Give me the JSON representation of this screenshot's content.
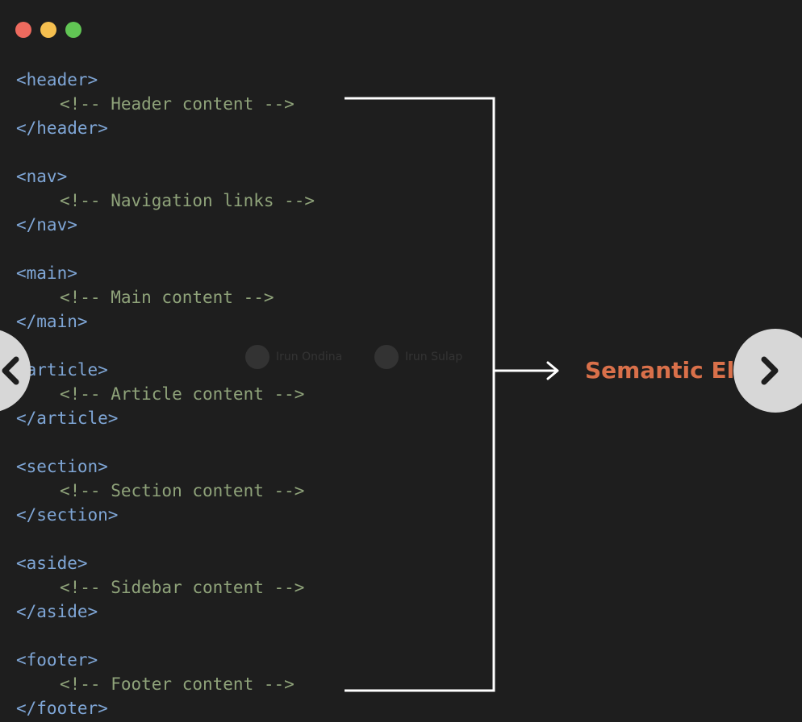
{
  "window": {
    "controls": [
      {
        "name": "close",
        "color": "#ed6a5e"
      },
      {
        "name": "minimize",
        "color": "#f5bf4f"
      },
      {
        "name": "maximize",
        "color": "#61c554"
      }
    ]
  },
  "code": [
    {
      "indent": false,
      "kind": "tag",
      "text": "<header>"
    },
    {
      "indent": true,
      "kind": "comment",
      "text": "<!-- Header content -->"
    },
    {
      "indent": false,
      "kind": "tag",
      "text": "</header>"
    },
    {
      "indent": false,
      "kind": "blank",
      "text": ""
    },
    {
      "indent": false,
      "kind": "tag",
      "text": "<nav>"
    },
    {
      "indent": true,
      "kind": "comment",
      "text": "<!-- Navigation links -->"
    },
    {
      "indent": false,
      "kind": "tag",
      "text": "</nav>"
    },
    {
      "indent": false,
      "kind": "blank",
      "text": ""
    },
    {
      "indent": false,
      "kind": "tag",
      "text": "<main>"
    },
    {
      "indent": true,
      "kind": "comment",
      "text": "<!-- Main content -->"
    },
    {
      "indent": false,
      "kind": "tag",
      "text": "</main>"
    },
    {
      "indent": false,
      "kind": "blank",
      "text": ""
    },
    {
      "indent": false,
      "kind": "tag",
      "text": "<article>"
    },
    {
      "indent": true,
      "kind": "comment",
      "text": "<!-- Article content -->"
    },
    {
      "indent": false,
      "kind": "tag",
      "text": "</article>"
    },
    {
      "indent": false,
      "kind": "blank",
      "text": ""
    },
    {
      "indent": false,
      "kind": "tag",
      "text": "<section>"
    },
    {
      "indent": true,
      "kind": "comment",
      "text": "<!-- Section content -->"
    },
    {
      "indent": false,
      "kind": "tag",
      "text": "</section>"
    },
    {
      "indent": false,
      "kind": "blank",
      "text": ""
    },
    {
      "indent": false,
      "kind": "tag",
      "text": "<aside>"
    },
    {
      "indent": true,
      "kind": "comment",
      "text": "<!-- Sidebar content -->"
    },
    {
      "indent": false,
      "kind": "tag",
      "text": "</aside>"
    },
    {
      "indent": false,
      "kind": "blank",
      "text": ""
    },
    {
      "indent": false,
      "kind": "tag",
      "text": "<footer>"
    },
    {
      "indent": true,
      "kind": "comment",
      "text": "<!-- Footer content -->"
    },
    {
      "indent": false,
      "kind": "tag",
      "text": "</footer>"
    }
  ],
  "diagram": {
    "label": "Semantic Elements",
    "label_color": "#d9704a",
    "line_color": "#ffffff"
  },
  "colors": {
    "background": "#1e1e1e",
    "tag": "#7fa6d6",
    "comment": "#8fa37a",
    "nav_button": "#d7d7d7"
  },
  "carousel": {
    "prev_icon": "chevron-left-icon",
    "next_icon": "chevron-right-icon"
  },
  "watermark": {
    "authors": [
      {
        "name": "Irun Ondina"
      },
      {
        "name": "Irun Sulap"
      }
    ]
  }
}
